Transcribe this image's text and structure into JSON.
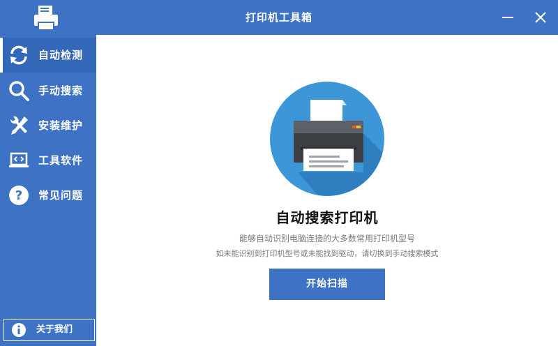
{
  "window": {
    "title": "打印机工具箱",
    "minimize_icon": "minimize-icon",
    "close_icon": "close-icon"
  },
  "brand": {
    "logo_icon": "printer-logo-icon"
  },
  "sidebar": {
    "items": [
      {
        "label": "自动检测",
        "icon": "refresh-icon",
        "active": true
      },
      {
        "label": "手动搜索",
        "icon": "search-icon",
        "active": false
      },
      {
        "label": "安装维护",
        "icon": "tools-icon",
        "active": false
      },
      {
        "label": "工具软件",
        "icon": "laptop-code-icon",
        "active": false
      },
      {
        "label": "常见问题",
        "icon": "question-icon",
        "active": false
      }
    ],
    "about": {
      "label": "关于我们",
      "icon": "info-icon"
    }
  },
  "main": {
    "hero_icon": "printer-illustration",
    "heading": "自动搜索打印机",
    "description_line1": "能够自动识别电脑连接的大多数常用打印机型号",
    "description_line2": "如未能识别到打印机型号或未能找到驱动，请切换到手动搜索模式",
    "scan_button": "开始扫描"
  },
  "colors": {
    "primary": "#3d72c4",
    "hero_circle": "#3d96d8",
    "printer_body": "#3b3f44",
    "text_muted": "#7a7a7a"
  }
}
